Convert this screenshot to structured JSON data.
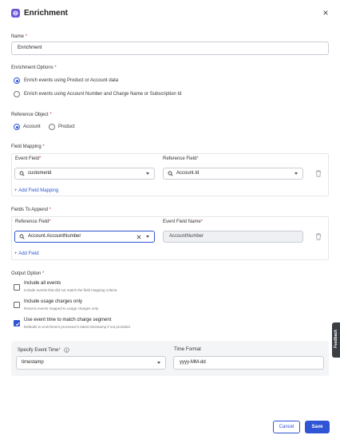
{
  "header": {
    "title": "Enrichment",
    "close_label": "×"
  },
  "name_field": {
    "label": "Name",
    "required": "*",
    "value": "Enrichment"
  },
  "enrichment_options": {
    "label": "Enrichment Options",
    "required": "*",
    "options": [
      {
        "label": "Enrich events using Product or Account data",
        "selected": true
      },
      {
        "label": "Enrich events using Account Number and Charge Name or Subscription Id",
        "selected": false
      }
    ]
  },
  "reference_object": {
    "label": "Reference Object",
    "required": "*",
    "options": [
      {
        "label": "Account",
        "selected": true
      },
      {
        "label": "Product",
        "selected": false
      }
    ]
  },
  "field_mapping": {
    "label": "Field Mapping",
    "required": "*",
    "event_field_label": "Event Field",
    "reference_field_label": "Reference Field",
    "rows": [
      {
        "event_field": "customerid",
        "reference_field": "Account.Id"
      }
    ],
    "add_link": "Add Field Mapping"
  },
  "fields_to_append": {
    "label": "Fields To Append",
    "required": "*",
    "reference_field_label": "Reference Field",
    "event_field_name_label": "Event Field Name",
    "rows": [
      {
        "reference_field": "Account.AccountNumber",
        "event_field_name": "AccountNumber"
      }
    ],
    "add_link": "Add Field"
  },
  "output_option": {
    "label": "Output Option",
    "required": "*",
    "checkboxes": [
      {
        "label": "Include all events",
        "description": "Include events that did not match the field mapping criteria",
        "checked": false
      },
      {
        "label": "Include usage charges only",
        "description": "Returns events mapped to usage charges only.",
        "checked": false
      },
      {
        "label": "Use event time to match charge segment",
        "description": "Defaults to enrichment processor's latest timestamp if not provided.",
        "checked": true
      }
    ]
  },
  "event_time": {
    "label": "Specify Event Time",
    "required": "*",
    "value": "timestamp",
    "time_format_label": "Time Format",
    "time_format_value": "yyyy-MM-dd"
  },
  "footer": {
    "cancel_label": "Cancel",
    "save_label": "Save"
  },
  "feedback_tab": {
    "label": "Feedback"
  },
  "colors": {
    "accent": "#2f55d4",
    "logo": "#6b57d8",
    "required": "#e03131"
  },
  "icons": [
    "enrichment-logo-icon",
    "close-icon",
    "search-icon",
    "chevron-down-icon",
    "clear-icon",
    "trash-icon",
    "plus-icon",
    "info-icon",
    "check-icon",
    "feedback-icon"
  ]
}
